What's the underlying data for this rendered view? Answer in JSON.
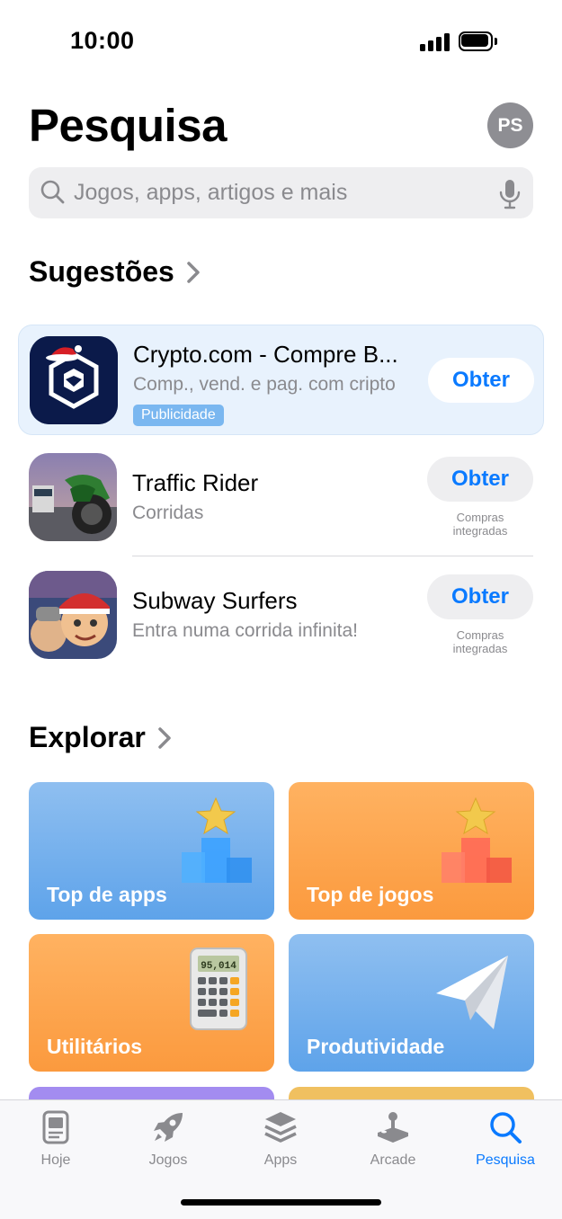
{
  "status_bar": {
    "time": "10:00"
  },
  "header": {
    "title": "Pesquisa",
    "avatar_initials": "PS"
  },
  "search": {
    "placeholder": "Jogos, apps, artigos e mais"
  },
  "suggestions": {
    "title": "Sugestões",
    "apps": [
      {
        "name": "Crypto.com - Compre B...",
        "subtitle": "Comp., vend. e pag. com cripto",
        "badge": "Publicidade",
        "button": "Obter",
        "icon": "crypto-com-icon"
      },
      {
        "name": "Traffic Rider",
        "subtitle": "Corridas",
        "button": "Obter",
        "iap_line1": "Compras",
        "iap_line2": "integradas",
        "icon": "traffic-rider-icon"
      },
      {
        "name": "Subway Surfers",
        "subtitle": "Entra numa corrida infinita!",
        "button": "Obter",
        "iap_line1": "Compras",
        "iap_line2": "integradas",
        "icon": "subway-surfers-icon"
      }
    ]
  },
  "explore": {
    "title": "Explorar",
    "cards": [
      {
        "label": "Top de apps",
        "color": "#6aa9ec",
        "icon": "podium-star-icon"
      },
      {
        "label": "Top de jogos",
        "color": "#fda14d",
        "icon": "podium-star-icon"
      },
      {
        "label": "Utilitários",
        "color": "#fda14d",
        "icon": "calculator-icon",
        "calculator_display": "95,014"
      },
      {
        "label": "Produtividade",
        "color": "#6aa9ec",
        "icon": "paper-plane-icon"
      }
    ]
  },
  "tabs": [
    {
      "label": "Hoje",
      "icon": "today-icon"
    },
    {
      "label": "Jogos",
      "icon": "rocket-icon"
    },
    {
      "label": "Apps",
      "icon": "layers-icon"
    },
    {
      "label": "Arcade",
      "icon": "joystick-icon"
    },
    {
      "label": "Pesquisa",
      "icon": "search-icon",
      "active": true
    }
  ],
  "colors": {
    "accent": "#0a7aff",
    "ad_background": "#e8f2fd",
    "ad_badge": "#7ab7f0"
  }
}
